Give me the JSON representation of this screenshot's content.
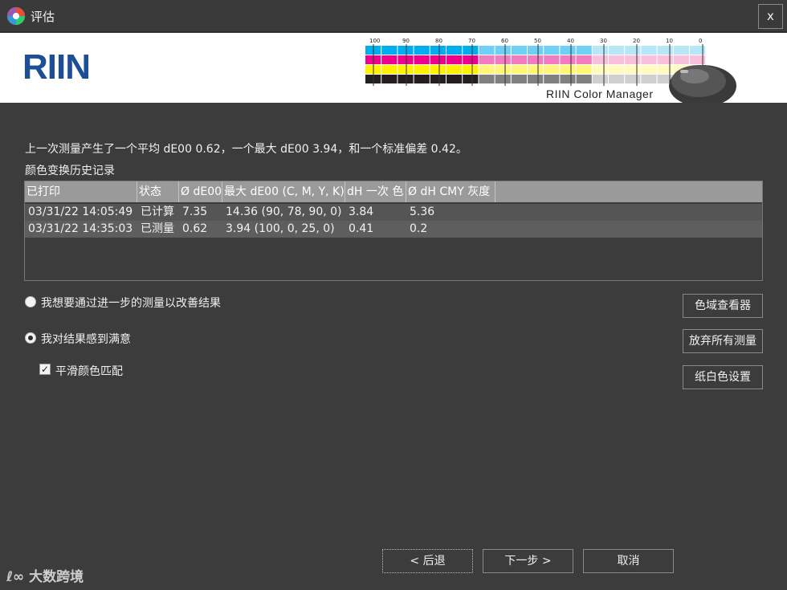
{
  "window": {
    "title": "评估",
    "close_label": "x",
    "icon": "color-wheel-icon"
  },
  "banner": {
    "brand": "RIIN",
    "caption": "RIIN Color Manager",
    "scale_labels": [
      "100",
      "90",
      "80",
      "70",
      "60",
      "50",
      "40",
      "30",
      "20",
      "10",
      "0"
    ],
    "brand_color": "#1e4e96"
  },
  "summary": {
    "text": "上一次测量产生了一个平均 dE00 0.62，一个最大 dE00 3.94，和一个标准偏差 0.42。",
    "history_label": "颜色变换历史记录"
  },
  "table": {
    "headers": [
      "已打印",
      "状态",
      "Ø dE00",
      "最大 dE00 (C, M, Y, K)",
      "dH 一次 色",
      "Ø dH CMY 灰度"
    ],
    "rows": [
      [
        "03/31/22 14:05:49",
        "已计算",
        "7.35",
        "14.36  (90, 78, 90, 0)",
        "3.84",
        "5.36"
      ],
      [
        "03/31/22 14:35:03",
        "已测量",
        "0.62",
        "3.94  (100, 0, 25, 0)",
        "0.41",
        "0.2"
      ]
    ]
  },
  "options": {
    "improve_label": "我想要通过进一步的测量以改善结果",
    "satisfied_label": "我对结果感到满意",
    "selected": "satisfied",
    "smooth_label": "平滑颜色匹配",
    "smooth_checked": true
  },
  "side_buttons": {
    "gamut_viewer": "色域查看器",
    "discard_all": "放弃所有测量",
    "paper_white": "纸白色设置"
  },
  "footer": {
    "back": "< 后退",
    "next": "下一步 >",
    "cancel": "取消"
  },
  "watermark": "大数跨境"
}
